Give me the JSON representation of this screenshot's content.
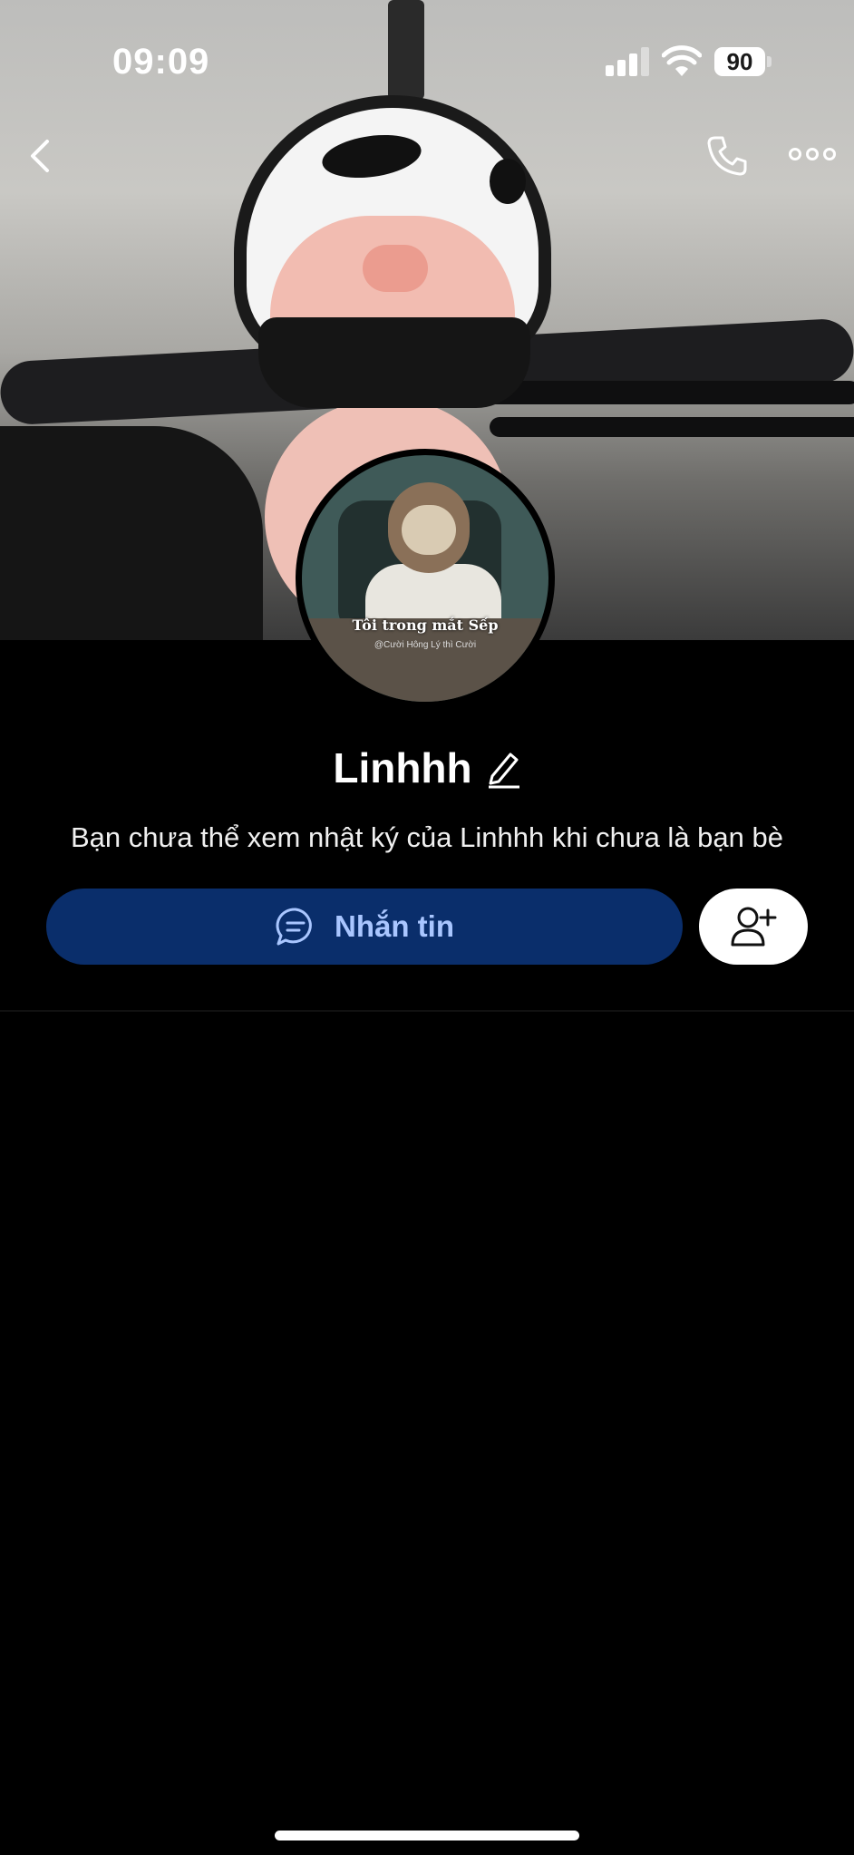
{
  "status_bar": {
    "time": "09:09",
    "battery": "90"
  },
  "nav": {
    "back_icon": "chevron-left-icon",
    "call_icon": "phone-icon",
    "more_icon": "more-dots-icon"
  },
  "cover": {
    "description_icon": "cover-photo"
  },
  "avatar": {
    "caption": "Tôi trong mắt Sếp",
    "watermark": "@Cười Hông Lý thì Cười"
  },
  "profile": {
    "name": "Linhhh",
    "notice": "Bạn chưa thể xem nhật ký của Linhhh khi chưa là bạn bè"
  },
  "actions": {
    "message_label": "Nhắn tin",
    "message_icon": "chat-bubble-icon",
    "add_friend_icon": "add-friend-icon"
  },
  "colors": {
    "accent_button": "#0a2e6b",
    "accent_text": "#a9c6ff",
    "background": "#000000"
  }
}
